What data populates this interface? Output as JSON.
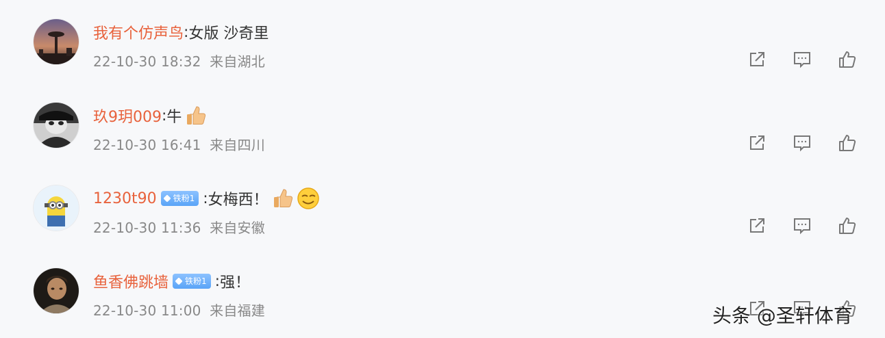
{
  "comments": [
    {
      "username": "我有个仿声鸟",
      "separator": ":",
      "text": "女版 沙奇里",
      "badge": null,
      "emojis": [],
      "time": "22-10-30 18:32",
      "location": "来自湖北"
    },
    {
      "username": "玖9玥009",
      "separator": ":",
      "text": "牛",
      "badge": null,
      "emojis": [
        "thumbs-up-emoji"
      ],
      "time": "22-10-30 16:41",
      "location": "来自四川"
    },
    {
      "username": "1230t90",
      "separator": ":",
      "text": "女梅西！",
      "badge": "铁粉1",
      "emojis": [
        "thumbs-up-emoji",
        "smirk-emoji"
      ],
      "time": "22-10-30 11:36",
      "location": "来自安徽"
    },
    {
      "username": "鱼香佛跳墙",
      "separator": ":",
      "text": "强！",
      "badge": "铁粉1",
      "emojis": [],
      "time": "22-10-30 11:00",
      "location": "来自福建"
    }
  ],
  "actions": {
    "icons": [
      "share-icon",
      "comment-icon",
      "like-icon"
    ]
  },
  "colors": {
    "username": "#e8623c",
    "meta": "#888888",
    "badge": "#5aa4f7",
    "background": "#f7f8fa"
  },
  "watermark": "头条 @圣轩体育"
}
